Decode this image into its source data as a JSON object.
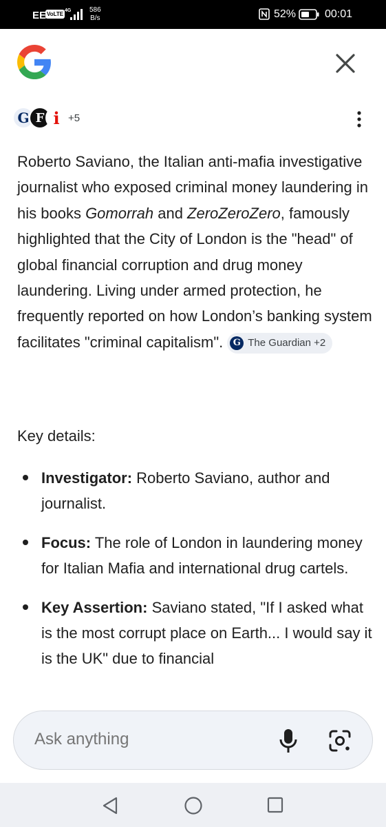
{
  "status_bar": {
    "carrier": "EE",
    "volte": "VoLTE",
    "network": "4G",
    "speed_value": "586",
    "speed_unit": "B/s",
    "battery_percent": "52%",
    "time": "00:01"
  },
  "header": {
    "logo_icon": "google-g-icon",
    "close_icon": "close-icon"
  },
  "sources": {
    "icons": [
      "G",
      "F",
      "i"
    ],
    "extra_count": "+5"
  },
  "answer": {
    "part1": "Roberto Saviano, the Italian anti-mafia investigative journalist who exposed criminal money laundering in his books ",
    "book1": "Gomorrah",
    "and": " and ",
    "book2": "ZeroZeroZero",
    "part2": ", famously highlighted that the City of London is the \"head\" of global financial corruption and drug money laundering. Living under armed protection, he frequently reported on how London’s banking system facilitates \"criminal capitalism\".",
    "citation": {
      "logo": "G",
      "label": "The Guardian +2"
    }
  },
  "key_details": {
    "heading": "Key details:",
    "items": [
      {
        "label": "Investigator:",
        "text": " Roberto Saviano, author and journalist."
      },
      {
        "label": "Focus:",
        "text": " The role of London in laundering money for Italian Mafia and international drug cartels."
      },
      {
        "label": "Key Assertion:",
        "text": " Saviano stated, \"If I asked what is the most corrupt place on Earth... I would say it is the UK\" due to financial"
      }
    ]
  },
  "search": {
    "placeholder": "Ask anything",
    "mic_icon": "microphone-icon",
    "lens_icon": "google-lens-icon"
  },
  "nav": {
    "back_icon": "back-icon",
    "home_icon": "home-icon",
    "recent_icon": "recent-apps-icon"
  },
  "colors": {
    "google_blue": "#4285F4",
    "google_red": "#EA4335",
    "google_yellow": "#FBBC05",
    "google_green": "#34A853",
    "text": "#1f1f1f",
    "chip_bg": "#eceff4",
    "search_bg": "#f0f3f8"
  }
}
